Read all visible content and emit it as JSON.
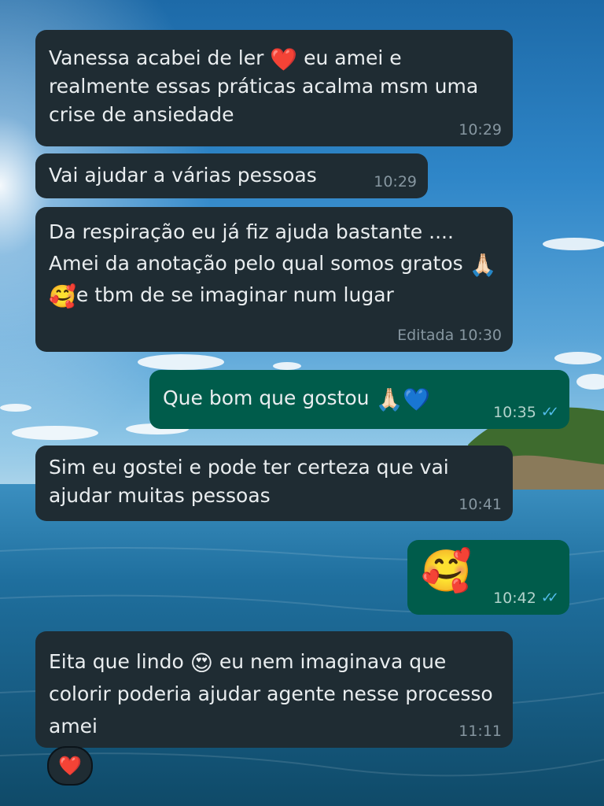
{
  "messages": [
    {
      "side": "in",
      "text_parts": [
        "Vanessa acabei de ler ",
        "❤️",
        " eu amei e realmente essas práticas acalma msm uma crise de ansiedade"
      ],
      "time": "10:29"
    },
    {
      "side": "in",
      "text": "Vai ajudar a várias pessoas",
      "time": "10:29"
    },
    {
      "side": "in",
      "text_parts": [
        "Da respiração eu já fiz ajuda bastante .... Amei da anotação pelo qual somos gratos ",
        "🙏🏻",
        " ",
        "🥰",
        "e tbm de se imaginar num lugar"
      ],
      "edited_label": "Editada",
      "time": "10:30"
    },
    {
      "side": "out",
      "text_parts": [
        "Que bom que gostou ",
        "🙏🏻",
        "💙"
      ],
      "time": "10:35",
      "status": "read"
    },
    {
      "side": "in",
      "text": "Sim eu gostei e pode ter certeza que vai ajudar muitas pessoas",
      "time": "10:41"
    },
    {
      "side": "out",
      "emoji": "🥰",
      "time": "10:42",
      "status": "read"
    },
    {
      "side": "in",
      "text_parts": [
        "Eita que lindo ",
        "😍",
        " eu nem imaginava que colorir poderia ajudar agente nesse processo amei"
      ],
      "time": "11:11",
      "reaction": "❤️"
    }
  ],
  "icons": {
    "read_ticks": "double-check-icon"
  },
  "colors": {
    "incoming_bubble": "#1f2c33",
    "outgoing_bubble": "#005c4b",
    "read_ticks": "#53bdeb",
    "timestamp": "#8696a0"
  }
}
